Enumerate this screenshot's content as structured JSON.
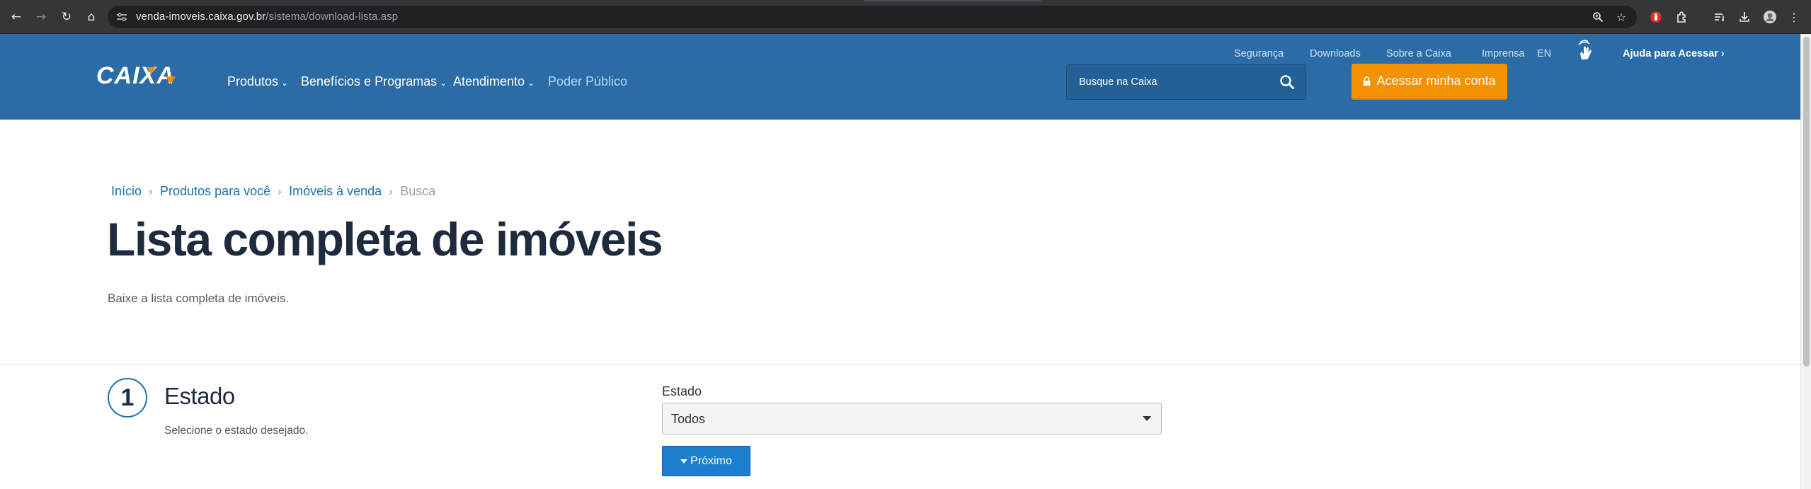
{
  "browser": {
    "url_host": "venda-imoveis.caixa.gov.br",
    "url_path": "/sistema/download-lista.asp",
    "icons": [
      "back-icon",
      "forward-icon",
      "reload-icon",
      "home-icon",
      "site-info-icon",
      "zoom-icon",
      "bookmark-star-icon",
      "extension-red-icon",
      "extensions-puzzle-icon",
      "tab-search-icon",
      "download-icon",
      "profile-avatar-icon",
      "menu-kebab-icon"
    ]
  },
  "header": {
    "logo_text": "CAIXA",
    "top_links": [
      "Segurança",
      "Downloads",
      "Sobre a Caixa",
      "Imprensa",
      "EN"
    ],
    "help_link": "Ajuda para Acessar ›",
    "nav": [
      {
        "label": "Produtos",
        "has_dropdown": true
      },
      {
        "label": "Benefícios e Programas",
        "has_dropdown": true
      },
      {
        "label": "Atendimento",
        "has_dropdown": true
      },
      {
        "label": "Poder Público",
        "has_dropdown": false
      }
    ],
    "search_placeholder": "Busque na Caixa",
    "login_label": "Acessar minha conta",
    "colors": {
      "header_bg": "#2b6ca7",
      "login_bg": "#f39200"
    }
  },
  "main": {
    "breadcrumb": [
      "Início",
      "Produtos para você",
      "Imóveis à venda",
      "Busca"
    ],
    "breadcrumb_sep": "›",
    "title": "Lista completa de imóveis",
    "description": "Baixe a lista completa de imóveis.",
    "step": {
      "number": "1",
      "title": "Estado",
      "description": "Selecione o estado desejado."
    },
    "form": {
      "field_label": "Estado",
      "select_value": "Todos",
      "next_label": "Próximo"
    }
  }
}
